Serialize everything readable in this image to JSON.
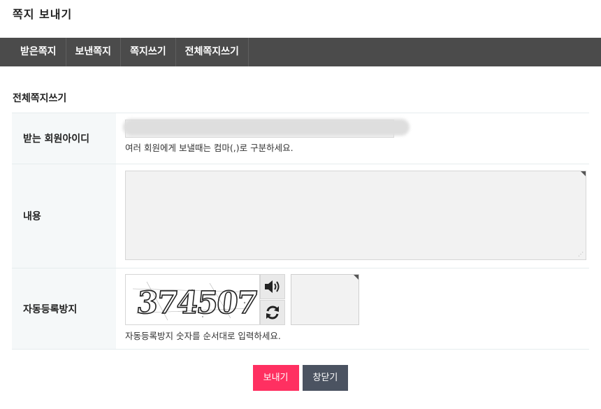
{
  "window": {
    "title": "쪽지 보내기"
  },
  "tabs": [
    {
      "label": "받은쪽지"
    },
    {
      "label": "보낸쪽지"
    },
    {
      "label": "쪽지쓰기"
    },
    {
      "label": "전체쪽지쓰기"
    }
  ],
  "section": {
    "title": "전체쪽지쓰기"
  },
  "form": {
    "recipient": {
      "label": "받는 회원아이디",
      "value": "",
      "help": "여러 회원에게 보낼때는 컴마(,)로 구분하세요."
    },
    "content": {
      "label": "내용",
      "value": ""
    },
    "captcha": {
      "label": "자동등록방지",
      "image_text": "374507",
      "audio_icon": "speaker-icon",
      "refresh_icon": "refresh-icon",
      "input_value": "",
      "help": "자동등록방지 숫자를 순서대로 입력하세요."
    }
  },
  "buttons": {
    "send": "보내기",
    "close": "창닫기"
  },
  "colors": {
    "tabbar": "#4b4b4b",
    "send": "#ff3061",
    "close": "#4b5361",
    "label_bg": "#f5f8f9"
  }
}
